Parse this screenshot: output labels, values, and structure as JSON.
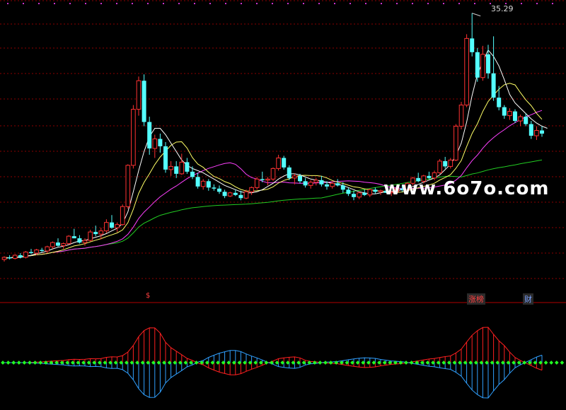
{
  "chart_data": {
    "type": "candlestick",
    "watermark": "www.6o7o.com",
    "peak_label": "35.29",
    "markers": [
      {
        "name": "s-marker",
        "text": "$",
        "bar": 27
      },
      {
        "name": "zhangbang-marker",
        "text": "涨榜",
        "bar": 86
      },
      {
        "name": "cai-marker",
        "text": "财",
        "bar": 97
      }
    ],
    "colors": {
      "background": "#000000",
      "up": "#ff3232",
      "down": "#54ffff",
      "grid": "#8b0000",
      "ma_fast": "#ffffff",
      "ma_mid": "#ffff66",
      "ma_slow": "#ff40ff",
      "ma_long": "#22cc22",
      "osc_up": "#ff2020",
      "osc_down": "#30a0ff",
      "osc_dot": "#22ff22"
    },
    "candles": [
      [
        12.0,
        12.3,
        11.8,
        12.2
      ],
      [
        12.2,
        12.4,
        12.0,
        12.1
      ],
      [
        12.1,
        12.5,
        12.0,
        12.4
      ],
      [
        12.4,
        12.6,
        12.1,
        12.2
      ],
      [
        12.2,
        12.8,
        12.1,
        12.7
      ],
      [
        12.7,
        13.0,
        12.5,
        12.6
      ],
      [
        12.6,
        13.0,
        12.4,
        12.9
      ],
      [
        12.9,
        13.1,
        12.7,
        12.8
      ],
      [
        12.8,
        13.3,
        12.6,
        13.2
      ],
      [
        13.2,
        13.7,
        13.0,
        13.6
      ],
      [
        13.6,
        14.0,
        13.2,
        13.3
      ],
      [
        13.3,
        13.6,
        13.0,
        13.5
      ],
      [
        13.5,
        14.3,
        13.4,
        14.2
      ],
      [
        14.2,
        14.9,
        14.0,
        14.0
      ],
      [
        14.0,
        14.3,
        13.5,
        13.6
      ],
      [
        13.6,
        14.0,
        13.3,
        13.8
      ],
      [
        13.8,
        14.8,
        13.7,
        14.6
      ],
      [
        14.6,
        15.2,
        14.2,
        14.4
      ],
      [
        14.4,
        15.0,
        13.9,
        14.7
      ],
      [
        14.7,
        15.8,
        14.5,
        15.5
      ],
      [
        15.5,
        16.2,
        14.9,
        15.0
      ],
      [
        15.0,
        15.5,
        14.6,
        15.3
      ],
      [
        15.3,
        17.2,
        15.2,
        17.0
      ],
      [
        17.0,
        21.0,
        16.8,
        20.9
      ],
      [
        20.9,
        26.6,
        20.6,
        26.2
      ],
      [
        26.2,
        29.3,
        25.6,
        28.9
      ],
      [
        28.9,
        29.5,
        24.6,
        25.0
      ],
      [
        25.0,
        25.5,
        21.9,
        22.5
      ],
      [
        22.5,
        23.8,
        21.6,
        23.4
      ],
      [
        23.4,
        23.9,
        22.1,
        22.7
      ],
      [
        22.7,
        23.1,
        20.2,
        20.5
      ],
      [
        20.5,
        21.3,
        19.9,
        20.8
      ],
      [
        20.8,
        21.3,
        19.7,
        20.1
      ],
      [
        20.1,
        22.0,
        20.0,
        21.2
      ],
      [
        21.2,
        21.6,
        20.1,
        20.3
      ],
      [
        20.3,
        20.8,
        19.6,
        19.8
      ],
      [
        19.8,
        20.2,
        18.7,
        18.9
      ],
      [
        18.9,
        19.6,
        18.6,
        19.4
      ],
      [
        19.4,
        19.6,
        18.5,
        18.8
      ],
      [
        18.8,
        19.1,
        18.5,
        18.7
      ],
      [
        18.7,
        19.0,
        18.2,
        18.4
      ],
      [
        18.4,
        18.6,
        17.8,
        18.0
      ],
      [
        18.0,
        18.4,
        17.9,
        18.3
      ],
      [
        18.3,
        18.6,
        18.0,
        18.1
      ],
      [
        18.1,
        18.5,
        17.6,
        17.8
      ],
      [
        17.8,
        18.6,
        17.7,
        18.4
      ],
      [
        18.4,
        18.9,
        18.1,
        18.8
      ],
      [
        18.8,
        19.8,
        18.6,
        19.6
      ],
      [
        19.6,
        20.3,
        19.3,
        19.5
      ],
      [
        19.5,
        19.8,
        19.0,
        19.6
      ],
      [
        19.6,
        20.7,
        19.4,
        20.6
      ],
      [
        20.6,
        21.9,
        20.4,
        21.6
      ],
      [
        21.6,
        21.8,
        20.5,
        20.7
      ],
      [
        20.7,
        20.9,
        19.5,
        19.7
      ],
      [
        19.7,
        20.1,
        19.1,
        19.9
      ],
      [
        19.9,
        20.1,
        19.2,
        19.4
      ],
      [
        19.4,
        19.7,
        18.8,
        19.0
      ],
      [
        19.0,
        19.5,
        18.7,
        19.3
      ],
      [
        19.3,
        19.7,
        19.0,
        19.5
      ],
      [
        19.5,
        19.9,
        18.9,
        19.1
      ],
      [
        19.1,
        19.4,
        18.6,
        18.9
      ],
      [
        18.9,
        19.4,
        18.7,
        19.2
      ],
      [
        19.2,
        19.6,
        18.9,
        19.0
      ],
      [
        19.0,
        19.3,
        18.3,
        18.6
      ],
      [
        18.6,
        18.8,
        18.0,
        18.2
      ],
      [
        18.2,
        18.5,
        17.6,
        17.9
      ],
      [
        17.9,
        18.4,
        17.7,
        18.3
      ],
      [
        18.3,
        18.6,
        18.0,
        18.1
      ],
      [
        18.1,
        18.7,
        17.9,
        18.6
      ],
      [
        18.6,
        18.8,
        18.2,
        18.4
      ],
      [
        18.4,
        18.6,
        18.1,
        18.5
      ],
      [
        18.5,
        18.9,
        18.3,
        18.3
      ],
      [
        18.3,
        18.5,
        18.0,
        18.4
      ],
      [
        18.4,
        18.8,
        18.2,
        18.7
      ],
      [
        18.7,
        19.0,
        18.4,
        18.6
      ],
      [
        18.6,
        19.3,
        18.5,
        19.2
      ],
      [
        19.2,
        19.8,
        19.0,
        19.7
      ],
      [
        19.7,
        20.2,
        19.3,
        19.4
      ],
      [
        19.4,
        20.0,
        19.2,
        19.9
      ],
      [
        19.9,
        20.3,
        19.6,
        19.7
      ],
      [
        19.7,
        20.4,
        19.5,
        20.2
      ],
      [
        20.2,
        21.5,
        20.1,
        21.3
      ],
      [
        21.3,
        21.7,
        20.6,
        20.8
      ],
      [
        20.8,
        21.6,
        20.6,
        21.4
      ],
      [
        21.4,
        24.8,
        21.3,
        24.6
      ],
      [
        24.6,
        26.9,
        24.3,
        26.6
      ],
      [
        26.6,
        33.3,
        26.4,
        32.9
      ],
      [
        32.9,
        35.29,
        31.2,
        31.6
      ],
      [
        31.6,
        32.0,
        28.8,
        29.2
      ],
      [
        29.2,
        32.2,
        28.9,
        31.4
      ],
      [
        31.4,
        32.3,
        29.1,
        29.6
      ],
      [
        29.6,
        33.1,
        27.0,
        27.3
      ],
      [
        27.3,
        28.4,
        26.1,
        26.4
      ],
      [
        26.4,
        26.6,
        25.3,
        25.6
      ],
      [
        25.6,
        26.3,
        25.2,
        26.0
      ],
      [
        26.0,
        26.2,
        24.9,
        25.1
      ],
      [
        25.1,
        25.7,
        24.6,
        25.5
      ],
      [
        25.5,
        25.8,
        24.6,
        24.8
      ],
      [
        24.8,
        25.1,
        23.4,
        23.7
      ],
      [
        23.7,
        24.6,
        23.3,
        24.2
      ],
      [
        24.2,
        24.6,
        23.6,
        23.9
      ]
    ],
    "ma_fast": [
      12.1,
      12.15,
      12.2,
      12.18,
      12.3,
      12.4,
      12.55,
      12.65,
      12.8,
      13.0,
      13.15,
      13.25,
      13.4,
      13.6,
      13.75,
      13.8,
      13.95,
      14.1,
      14.25,
      14.45,
      14.7,
      14.95,
      15.4,
      16.5,
      18.4,
      20.4,
      22.2,
      23.6,
      24.4,
      24.4,
      23.8,
      23.0,
      22.2,
      21.4,
      20.9,
      20.6,
      20.4,
      20.2,
      19.9,
      19.6,
      19.3,
      19.0,
      18.8,
      18.6,
      18.4,
      18.3,
      18.3,
      18.4,
      18.6,
      18.9,
      19.2,
      19.6,
      19.9,
      20.1,
      20.1,
      20.0,
      19.8,
      19.6,
      19.5,
      19.4,
      19.3,
      19.2,
      19.1,
      19.0,
      18.8,
      18.6,
      18.4,
      18.3,
      18.2,
      18.2,
      18.3,
      18.4,
      18.45,
      18.5,
      18.6,
      18.7,
      18.9,
      19.1,
      19.3,
      19.5,
      19.7,
      20.0,
      20.5,
      21.0,
      21.8,
      23.0,
      25.0,
      27.5,
      29.5,
      30.7,
      31.8,
      31.2,
      30.3,
      29.0,
      27.6,
      26.8,
      26.3,
      25.8,
      25.3,
      24.9,
      24.6,
      24.4
    ]
  }
}
